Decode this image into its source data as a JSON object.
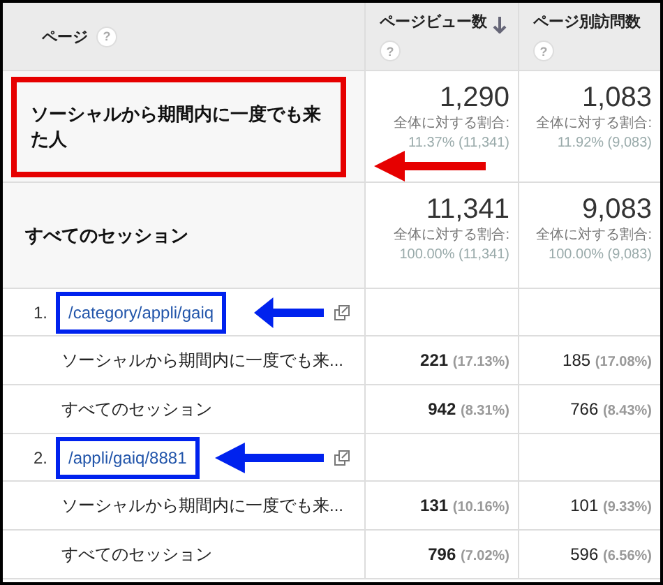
{
  "columns": [
    {
      "label": "ページ",
      "help": "?",
      "sorted": false
    },
    {
      "label": "ページビュー数",
      "help": "?",
      "sorted": true
    },
    {
      "label": "ページ別訪問数",
      "help": "?",
      "sorted": false
    }
  ],
  "rows": [
    {
      "kind": "summary",
      "label": "ソーシャルから期間内に一度でも来た人",
      "highlight": {
        "color": "#e60000"
      },
      "cells": [
        {
          "value": "1,290",
          "note_label": "全体に対する割合:",
          "note_value": "11.37% (11,341)"
        },
        {
          "value": "1,083",
          "note_label": "全体に対する割合:",
          "note_value": "11.92% (9,083)"
        }
      ]
    },
    {
      "kind": "summary",
      "label": "すべてのセッション",
      "cells": [
        {
          "value": "11,341",
          "note_label": "全体に対する割合:",
          "note_value": "100.00% (11,341)"
        },
        {
          "value": "9,083",
          "note_label": "全体に対する割合:",
          "note_value": "100.00% (9,083)"
        }
      ]
    },
    {
      "kind": "page",
      "index": "1.",
      "url": "/category/appli/gaiq",
      "highlight": {
        "color": "#0022ee"
      }
    },
    {
      "kind": "segment",
      "label": "ソーシャルから期間内に一度でも来...",
      "cells": [
        {
          "value": "221",
          "pct": "(17.13%)"
        },
        {
          "value": "185",
          "pct": "(17.08%)"
        }
      ]
    },
    {
      "kind": "segment",
      "label": "すべてのセッション",
      "cells": [
        {
          "value": "942",
          "pct": "(8.31%)"
        },
        {
          "value": "766",
          "pct": "(8.43%)"
        }
      ]
    },
    {
      "kind": "page",
      "index": "2.",
      "url": "/appli/gaiq/8881",
      "highlight": {
        "color": "#0022ee"
      }
    },
    {
      "kind": "segment",
      "label": "ソーシャルから期間内に一度でも来...",
      "cells": [
        {
          "value": "131",
          "pct": "(10.16%)"
        },
        {
          "value": "101",
          "pct": "(9.33%)"
        }
      ]
    },
    {
      "kind": "segment",
      "label": "すべてのセッション",
      "cells": [
        {
          "value": "796",
          "pct": "(7.02%)"
        },
        {
          "value": "596",
          "pct": "(6.56%)"
        }
      ]
    }
  ]
}
